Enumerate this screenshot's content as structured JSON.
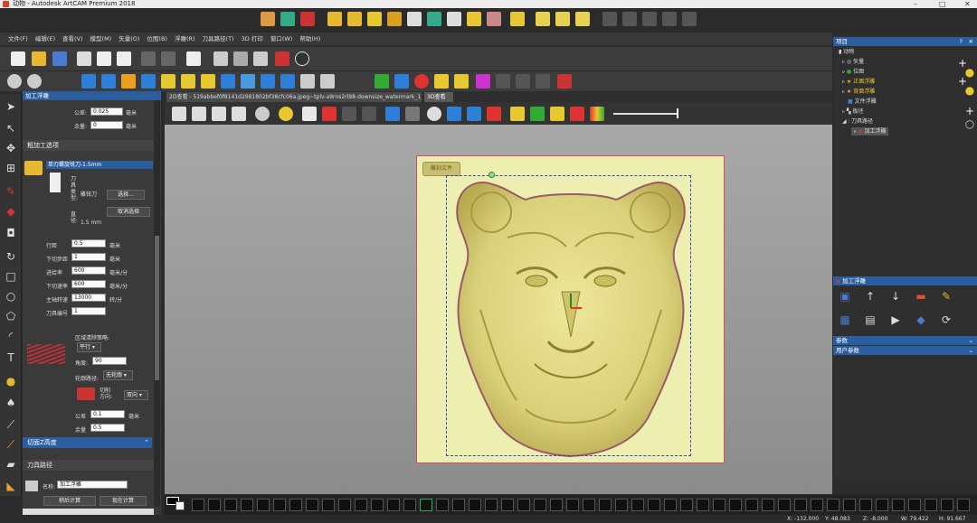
{
  "titlebar": {
    "title": "动物 - Autodesk ArtCAM Premium 2018",
    "min": "–",
    "max": "□",
    "close": "✕"
  },
  "menu": [
    "文件(F)",
    "编辑(E)",
    "查看(V)",
    "模型(M)",
    "矢量(O)",
    "位图(B)",
    "浮雕(R)",
    "刀具路径(T)",
    "3D 打印",
    "窗口(W)",
    "帮助(H)"
  ],
  "left_panel": {
    "title": "加工浮雕",
    "tolerance_label": "公差:",
    "tolerance_value": "0.025",
    "tolerance_unit": "毫米",
    "allowance_label": "余量:",
    "allowance_value": "0",
    "allowance_unit": "毫米",
    "roughing_section": "粗加工选项",
    "tool_name": "单刃螺旋铣刀-1.5mm",
    "tool_type_label": "刀具类型:",
    "tool_type_value": "雕铣刀",
    "diameter_label": "直径:",
    "diameter_value": "1.5 mm",
    "select_button": "选择...",
    "deselect_button": "取消选择",
    "stepover_label": "行距",
    "stepover_value": "0.5",
    "stepover_unit": "毫米",
    "stepdown_label": "下切步距",
    "stepdown_value": "1",
    "stepdown_unit": "毫米",
    "feed_label": "进给率",
    "feed_value": "600",
    "feed_unit": "毫米/分",
    "plunge_label": "下切速率",
    "plunge_value": "600",
    "plunge_unit": "毫米/分",
    "spindle_label": "主轴转速",
    "spindle_value": "13000",
    "spindle_unit": "转/分",
    "toolnum_label": "刀具编号",
    "toolnum_value": "1",
    "strategy_label": "区域清除策略:",
    "strategy_value": "平行",
    "angle_label": "角度:",
    "angle_value": "90",
    "profile_label": "轮廓路径:",
    "profile_value": "无轮廓",
    "cut_dir_label": "切削方向:",
    "cut_dir_value": "双向",
    "tol2_label": "公差",
    "tol2_value": "0.1",
    "tol2_unit": "毫米",
    "allow2_label": "余量",
    "allow2_value": "0.5",
    "slice_section": "切面Z高度",
    "toolpath_section": "刀具路径",
    "name_label": "名称:",
    "name_value": "加工浮雕",
    "calc_later": "稍后计算",
    "calc_now": "现在计算"
  },
  "tabs": {
    "tab_2d": "2D查看 - 519abbef0f8141d2981802bf38cfc06a.jpeg~tplv-a9rns2rl98-downsize_watermark_1_5_b",
    "tab_3d": "3D查看"
  },
  "right_panel": {
    "project_title": "项目",
    "help_btn": "?",
    "close_btn": "✕",
    "tree": [
      {
        "label": "动物",
        "color": "#ffffff"
      },
      {
        "label": "矢量",
        "color": "#ffffff"
      },
      {
        "label": "位图",
        "color": "#ffffff"
      },
      {
        "label": "正面浮雕",
        "color": "#f0c030"
      },
      {
        "label": "背面浮雕",
        "color": "#f0c030"
      },
      {
        "label": "文件浮雕",
        "color": "#ffffff"
      },
      {
        "label": "板坯",
        "color": "#ffffff"
      },
      {
        "label": "刀具路径",
        "color": "#ffffff"
      },
      {
        "label": "加工浮雕",
        "color": "#ffffff"
      }
    ],
    "tool_panel_title": "加工浮雕",
    "params_label": "参数",
    "user_params_label": "用户参数"
  },
  "status": {
    "x": "X: -132.000",
    "y": "Y: 48.083",
    "z": "Z: -8.000",
    "w": "W: 79.422",
    "h": "H: 91.667"
  },
  "canvas": {
    "watermark_text": "雕刻文件"
  },
  "colors": {
    "accent": "#2a5e9e",
    "relief": "#d9d48a",
    "canvas_bg": "#ecefb0",
    "selection": "#3344cc"
  }
}
